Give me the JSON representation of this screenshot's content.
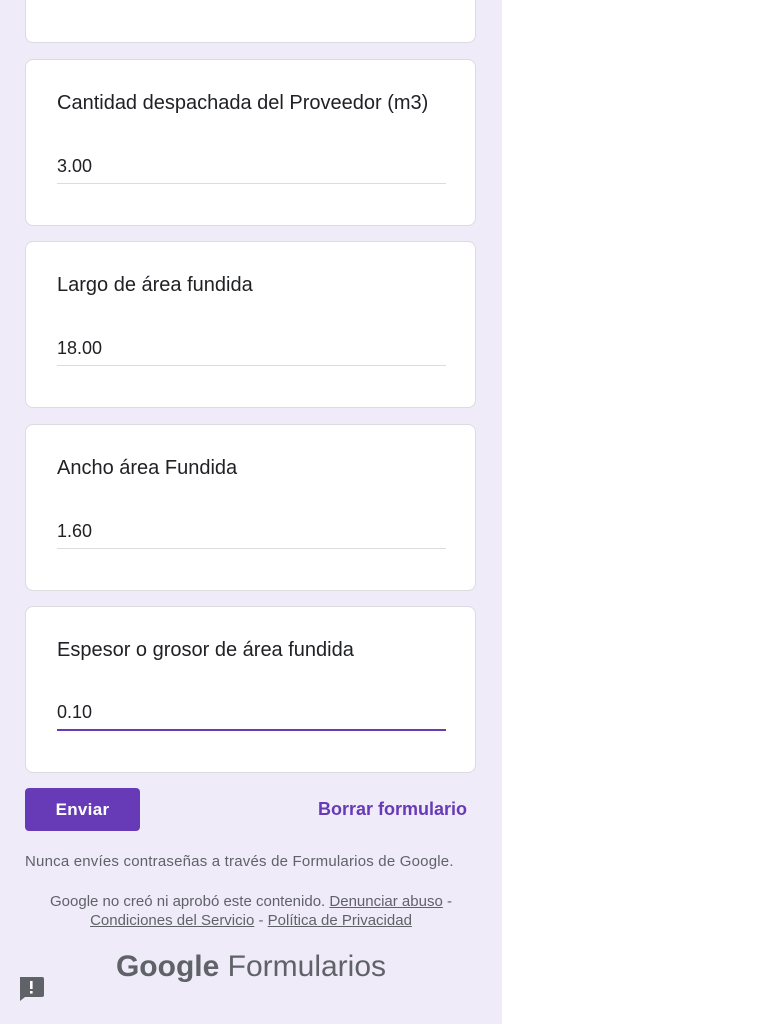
{
  "questions": [
    {
      "title": "Cantidad despachada del Proveedor (m3)",
      "value": "3.00"
    },
    {
      "title": "Largo de área fundida",
      "value": "18.00"
    },
    {
      "title": "Ancho área Fundida",
      "value": "1.60"
    },
    {
      "title": "Espesor o grosor de área  fundida",
      "value": "0.10"
    }
  ],
  "actions": {
    "submit_label": "Enviar",
    "clear_label": "Borrar formulario"
  },
  "footer": {
    "warning": "Nunca envíes contraseñas a través de Formularios de Google.",
    "disclaimer": "Google no creó ni aprobó este contenido.",
    "report_abuse": "Denunciar abuso",
    "separator": "-",
    "terms": "Condiciones del Servicio",
    "privacy": "Política de Privacidad",
    "brand_google": "Google",
    "brand_product": "Formularios"
  },
  "colors": {
    "accent": "#673ab7",
    "background": "#efebf8"
  },
  "icons": {
    "report": "report-problem-icon"
  }
}
